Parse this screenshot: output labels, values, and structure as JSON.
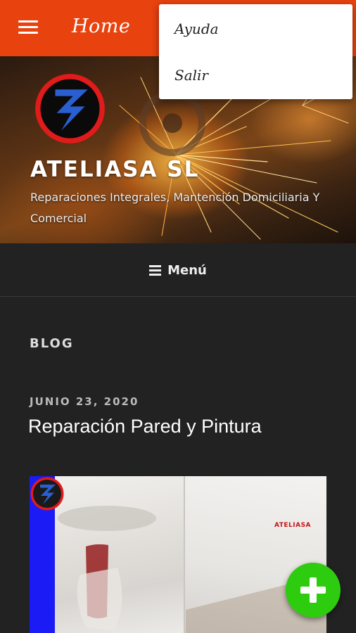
{
  "app_bar": {
    "title": "Home",
    "menu_icon": "hamburger-icon",
    "background_color": "#e8420f"
  },
  "overflow_menu": {
    "items": [
      {
        "label": "Ayuda"
      },
      {
        "label": "Salir"
      }
    ]
  },
  "header": {
    "logo_icon": "ateliasa-logo",
    "site_title": "ATELIASA SL",
    "site_description": "Reparaciones Integrales, Mantención Domiciliaria Y Comercial"
  },
  "nav": {
    "menu_icon": "bars-icon",
    "menu_label": "Menú"
  },
  "content": {
    "section_title": "BLOG",
    "posts": [
      {
        "date": "JUNIO 23, 2020",
        "title": "Reparación Pared y Pintura",
        "thumbnail_brand": "ATELIASA"
      }
    ]
  },
  "fab": {
    "icon": "plus-icon",
    "color": "#2ecc0f"
  }
}
